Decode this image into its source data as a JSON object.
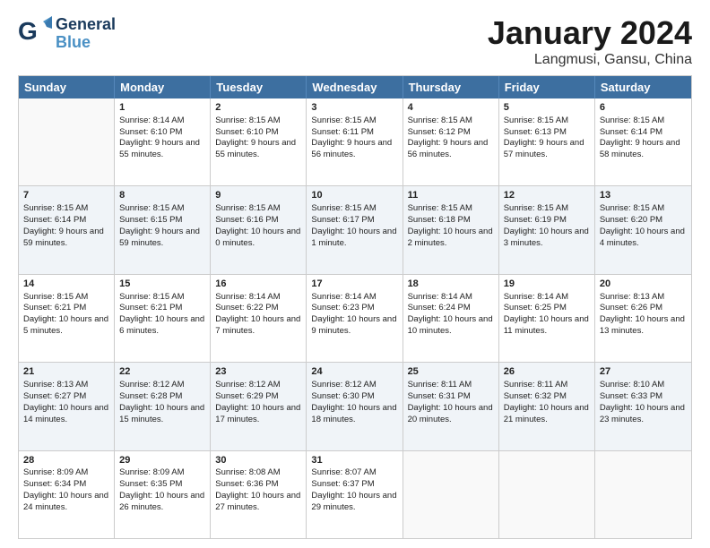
{
  "header": {
    "logo_general": "General",
    "logo_blue": "Blue",
    "title": "January 2024",
    "subtitle": "Langmusi, Gansu, China"
  },
  "weekdays": [
    "Sunday",
    "Monday",
    "Tuesday",
    "Wednesday",
    "Thursday",
    "Friday",
    "Saturday"
  ],
  "rows": [
    [
      {
        "day": "",
        "sunrise": "",
        "sunset": "",
        "daylight": "",
        "empty": true
      },
      {
        "day": "1",
        "sunrise": "Sunrise: 8:14 AM",
        "sunset": "Sunset: 6:10 PM",
        "daylight": "Daylight: 9 hours and 55 minutes."
      },
      {
        "day": "2",
        "sunrise": "Sunrise: 8:15 AM",
        "sunset": "Sunset: 6:10 PM",
        "daylight": "Daylight: 9 hours and 55 minutes."
      },
      {
        "day": "3",
        "sunrise": "Sunrise: 8:15 AM",
        "sunset": "Sunset: 6:11 PM",
        "daylight": "Daylight: 9 hours and 56 minutes."
      },
      {
        "day": "4",
        "sunrise": "Sunrise: 8:15 AM",
        "sunset": "Sunset: 6:12 PM",
        "daylight": "Daylight: 9 hours and 56 minutes."
      },
      {
        "day": "5",
        "sunrise": "Sunrise: 8:15 AM",
        "sunset": "Sunset: 6:13 PM",
        "daylight": "Daylight: 9 hours and 57 minutes."
      },
      {
        "day": "6",
        "sunrise": "Sunrise: 8:15 AM",
        "sunset": "Sunset: 6:14 PM",
        "daylight": "Daylight: 9 hours and 58 minutes."
      }
    ],
    [
      {
        "day": "7",
        "sunrise": "Sunrise: 8:15 AM",
        "sunset": "Sunset: 6:14 PM",
        "daylight": "Daylight: 9 hours and 59 minutes."
      },
      {
        "day": "8",
        "sunrise": "Sunrise: 8:15 AM",
        "sunset": "Sunset: 6:15 PM",
        "daylight": "Daylight: 9 hours and 59 minutes."
      },
      {
        "day": "9",
        "sunrise": "Sunrise: 8:15 AM",
        "sunset": "Sunset: 6:16 PM",
        "daylight": "Daylight: 10 hours and 0 minutes."
      },
      {
        "day": "10",
        "sunrise": "Sunrise: 8:15 AM",
        "sunset": "Sunset: 6:17 PM",
        "daylight": "Daylight: 10 hours and 1 minute."
      },
      {
        "day": "11",
        "sunrise": "Sunrise: 8:15 AM",
        "sunset": "Sunset: 6:18 PM",
        "daylight": "Daylight: 10 hours and 2 minutes."
      },
      {
        "day": "12",
        "sunrise": "Sunrise: 8:15 AM",
        "sunset": "Sunset: 6:19 PM",
        "daylight": "Daylight: 10 hours and 3 minutes."
      },
      {
        "day": "13",
        "sunrise": "Sunrise: 8:15 AM",
        "sunset": "Sunset: 6:20 PM",
        "daylight": "Daylight: 10 hours and 4 minutes."
      }
    ],
    [
      {
        "day": "14",
        "sunrise": "Sunrise: 8:15 AM",
        "sunset": "Sunset: 6:21 PM",
        "daylight": "Daylight: 10 hours and 5 minutes."
      },
      {
        "day": "15",
        "sunrise": "Sunrise: 8:15 AM",
        "sunset": "Sunset: 6:21 PM",
        "daylight": "Daylight: 10 hours and 6 minutes."
      },
      {
        "day": "16",
        "sunrise": "Sunrise: 8:14 AM",
        "sunset": "Sunset: 6:22 PM",
        "daylight": "Daylight: 10 hours and 7 minutes."
      },
      {
        "day": "17",
        "sunrise": "Sunrise: 8:14 AM",
        "sunset": "Sunset: 6:23 PM",
        "daylight": "Daylight: 10 hours and 9 minutes."
      },
      {
        "day": "18",
        "sunrise": "Sunrise: 8:14 AM",
        "sunset": "Sunset: 6:24 PM",
        "daylight": "Daylight: 10 hours and 10 minutes."
      },
      {
        "day": "19",
        "sunrise": "Sunrise: 8:14 AM",
        "sunset": "Sunset: 6:25 PM",
        "daylight": "Daylight: 10 hours and 11 minutes."
      },
      {
        "day": "20",
        "sunrise": "Sunrise: 8:13 AM",
        "sunset": "Sunset: 6:26 PM",
        "daylight": "Daylight: 10 hours and 13 minutes."
      }
    ],
    [
      {
        "day": "21",
        "sunrise": "Sunrise: 8:13 AM",
        "sunset": "Sunset: 6:27 PM",
        "daylight": "Daylight: 10 hours and 14 minutes."
      },
      {
        "day": "22",
        "sunrise": "Sunrise: 8:12 AM",
        "sunset": "Sunset: 6:28 PM",
        "daylight": "Daylight: 10 hours and 15 minutes."
      },
      {
        "day": "23",
        "sunrise": "Sunrise: 8:12 AM",
        "sunset": "Sunset: 6:29 PM",
        "daylight": "Daylight: 10 hours and 17 minutes."
      },
      {
        "day": "24",
        "sunrise": "Sunrise: 8:12 AM",
        "sunset": "Sunset: 6:30 PM",
        "daylight": "Daylight: 10 hours and 18 minutes."
      },
      {
        "day": "25",
        "sunrise": "Sunrise: 8:11 AM",
        "sunset": "Sunset: 6:31 PM",
        "daylight": "Daylight: 10 hours and 20 minutes."
      },
      {
        "day": "26",
        "sunrise": "Sunrise: 8:11 AM",
        "sunset": "Sunset: 6:32 PM",
        "daylight": "Daylight: 10 hours and 21 minutes."
      },
      {
        "day": "27",
        "sunrise": "Sunrise: 8:10 AM",
        "sunset": "Sunset: 6:33 PM",
        "daylight": "Daylight: 10 hours and 23 minutes."
      }
    ],
    [
      {
        "day": "28",
        "sunrise": "Sunrise: 8:09 AM",
        "sunset": "Sunset: 6:34 PM",
        "daylight": "Daylight: 10 hours and 24 minutes."
      },
      {
        "day": "29",
        "sunrise": "Sunrise: 8:09 AM",
        "sunset": "Sunset: 6:35 PM",
        "daylight": "Daylight: 10 hours and 26 minutes."
      },
      {
        "day": "30",
        "sunrise": "Sunrise: 8:08 AM",
        "sunset": "Sunset: 6:36 PM",
        "daylight": "Daylight: 10 hours and 27 minutes."
      },
      {
        "day": "31",
        "sunrise": "Sunrise: 8:07 AM",
        "sunset": "Sunset: 6:37 PM",
        "daylight": "Daylight: 10 hours and 29 minutes."
      },
      {
        "day": "",
        "sunrise": "",
        "sunset": "",
        "daylight": "",
        "empty": true
      },
      {
        "day": "",
        "sunrise": "",
        "sunset": "",
        "daylight": "",
        "empty": true
      },
      {
        "day": "",
        "sunrise": "",
        "sunset": "",
        "daylight": "",
        "empty": true
      }
    ]
  ]
}
